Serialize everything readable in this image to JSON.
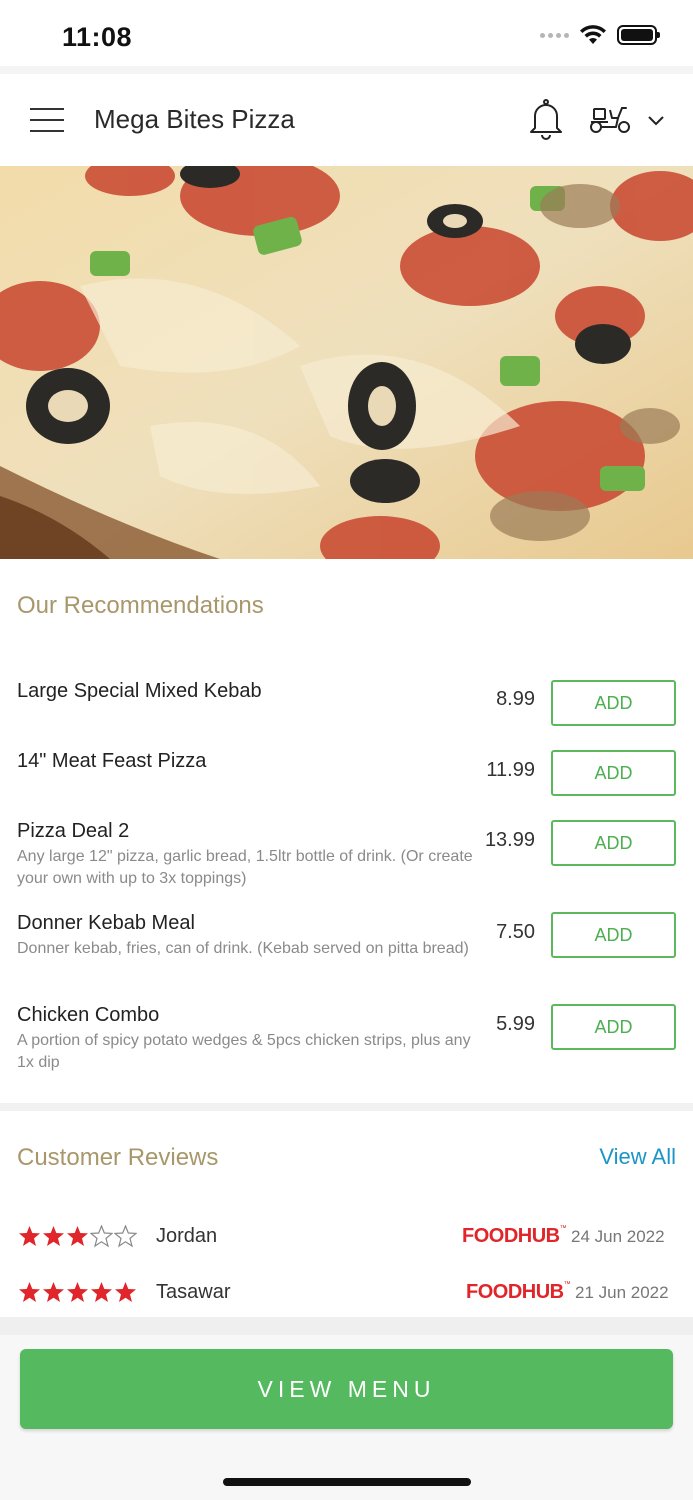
{
  "status_bar": {
    "time": "11:08"
  },
  "header": {
    "title": "Mega Bites Pizza"
  },
  "icons": {
    "menu": "hamburger-menu-icon",
    "bell": "bell-icon",
    "delivery": "scooter-icon",
    "chevron": "chevron-down-icon"
  },
  "hero": {
    "image": "pizza-photo"
  },
  "recommendations": {
    "title": "Our Recommendations",
    "items": [
      {
        "name": "Large Special Mixed Kebab",
        "desc": "",
        "price": "8.99",
        "button": "ADD"
      },
      {
        "name": "14\" Meat Feast Pizza",
        "desc": "",
        "price": "11.99",
        "button": "ADD"
      },
      {
        "name": "Pizza Deal 2",
        "desc": "Any large 12\" pizza, garlic bread, 1.5ltr bottle of drink. (Or create your own with up to 3x toppings)",
        "price": "13.99",
        "button": "ADD"
      },
      {
        "name": "Donner Kebab Meal",
        "desc": "Donner kebab, fries, can of drink. (Kebab served on pitta bread)",
        "price": "7.50",
        "button": "ADD"
      },
      {
        "name": "Chicken Combo",
        "desc": "A portion of spicy potato wedges & 5pcs chicken strips, plus any 1x dip",
        "price": "5.99",
        "button": "ADD"
      }
    ]
  },
  "reviews": {
    "title": "Customer Reviews",
    "view_all": "View All",
    "items": [
      {
        "rating": 3,
        "max": 5,
        "name": "Jordan",
        "source": "FOODHUB",
        "date": "24 Jun 2022"
      },
      {
        "rating": 5,
        "max": 5,
        "name": "Tasawar",
        "source": "FOODHUB",
        "date": "21 Jun 2022"
      }
    ]
  },
  "footer": {
    "button": "VIEW MENU"
  },
  "colors": {
    "accent_green": "#55b960",
    "section_title": "#a8976a",
    "link_blue": "#1b95c6",
    "star_red": "#e0262a"
  }
}
